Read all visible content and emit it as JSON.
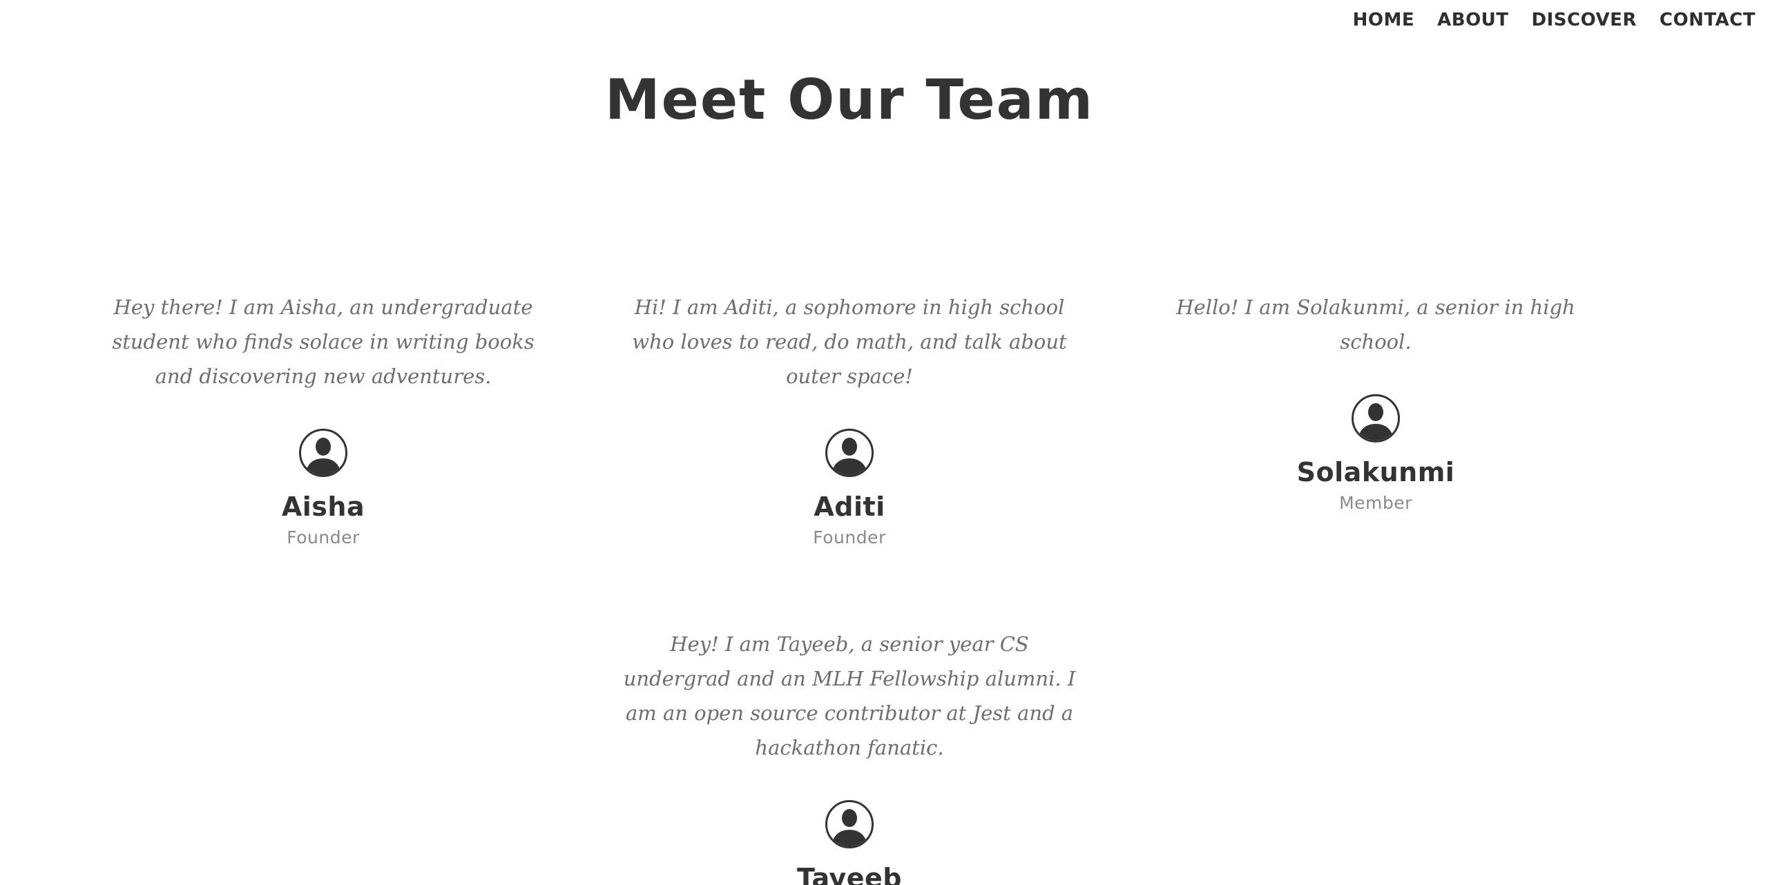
{
  "nav": {
    "items": [
      {
        "label": "HOME"
      },
      {
        "label": "ABOUT"
      },
      {
        "label": "DISCOVER"
      },
      {
        "label": "CONTACT"
      }
    ]
  },
  "page": {
    "title": "Meet Our Team"
  },
  "team": [
    {
      "bio": "Hey there! I am Aisha, an undergraduate student who finds solace in writing books and discovering new adventures.",
      "name": "Aisha",
      "role": "Founder",
      "avatar_icon": "user-avatar-icon"
    },
    {
      "bio": "Hi! I am Aditi, a sophomore in high school who loves to read, do math, and talk about outer space!",
      "name": "Aditi",
      "role": "Founder",
      "avatar_icon": "user-avatar-icon"
    },
    {
      "bio": "Hello! I am Solakunmi, a senior in high school.",
      "name": "Solakunmi",
      "role": "Member",
      "avatar_icon": "user-avatar-icon"
    },
    {
      "bio": "Hey! I am Tayeeb, a senior year CS undergrad and an MLH Fellowship alumni. I am an open source contributor at Jest and a hackathon fanatic.",
      "name": "Tayeeb",
      "role": "",
      "avatar_icon": "user-avatar-icon"
    }
  ],
  "colors": {
    "text_dark": "#333333",
    "bio_text": "#6e6e6e",
    "role_text": "#8a8a8a",
    "background": "#ffffff"
  }
}
